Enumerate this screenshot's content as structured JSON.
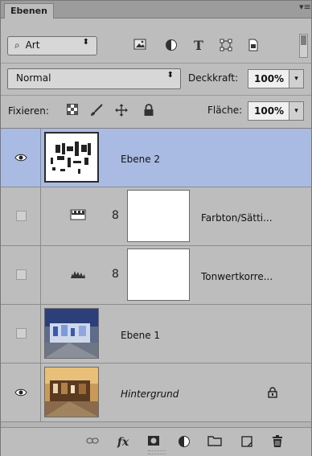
{
  "panel": {
    "tab_label": "Ebenen",
    "menu_glyph": "▾≡"
  },
  "filter": {
    "search_glyph": "⌕",
    "value": "Art",
    "arrow": "⬍",
    "icons": [
      "image-filter-icon",
      "adjustment-filter-icon",
      "type-filter-icon",
      "shape-filter-icon",
      "smart-object-filter-icon"
    ]
  },
  "blend": {
    "mode": "Normal",
    "arrow": "⬍",
    "opacity_label": "Deckkraft:",
    "opacity_value": "100%",
    "dropdown_glyph": "▾"
  },
  "lock": {
    "label": "Fixieren:",
    "fill_label": "Fläche:",
    "fill_value": "100%",
    "dropdown_glyph": "▾"
  },
  "layers": [
    {
      "name": "Ebene 2",
      "visible": true,
      "selected": true,
      "italic": false
    },
    {
      "name": "Farbton/Sätti...",
      "visible": false,
      "selected": false,
      "italic": false
    },
    {
      "name": "Tonwertkorre...",
      "visible": false,
      "selected": false,
      "italic": false
    },
    {
      "name": "Ebene 1",
      "visible": false,
      "selected": false,
      "italic": false
    },
    {
      "name": "Hintergrund",
      "visible": true,
      "selected": false,
      "italic": true,
      "locked": true
    }
  ],
  "glyphs": {
    "eye": "◉",
    "chain": "8",
    "lock": "🔒",
    "trash": "🗑"
  },
  "bottom": {
    "link": "⊖",
    "fx": "fx",
    "mask": "◙",
    "adjust": "◐",
    "folder": "▭",
    "new": "⧉",
    "delete": "⊔"
  },
  "colors": {
    "selected_row": "#a9bbe3",
    "panel_bg": "#bdbdbd"
  }
}
